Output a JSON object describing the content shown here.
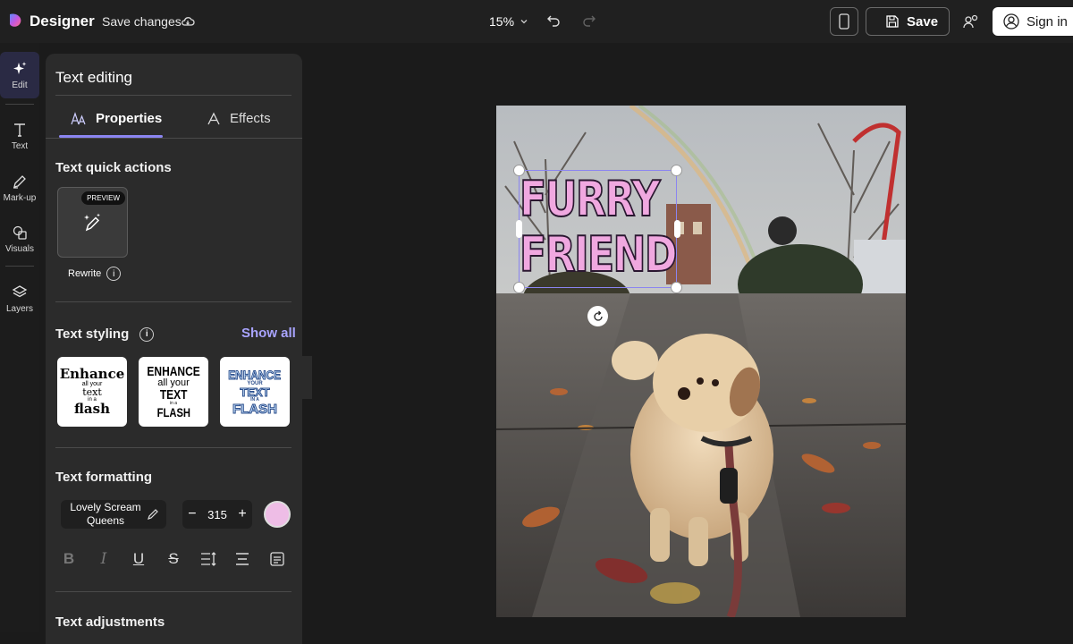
{
  "header": {
    "app_title": "Designer",
    "save_changes": "Save changes",
    "zoom": "15%",
    "save_label": "Save",
    "signin_label": "Sign in"
  },
  "rail": {
    "items": [
      {
        "label": "Edit",
        "icon": "sparkle-icon"
      },
      {
        "label": "Text",
        "icon": "text-icon"
      },
      {
        "label": "Mark-up",
        "icon": "pen-icon"
      },
      {
        "label": "Visuals",
        "icon": "shapes-icon"
      },
      {
        "label": "Layers",
        "icon": "layers-icon"
      }
    ]
  },
  "panel": {
    "title": "Text editing",
    "tabs": [
      {
        "label": "Properties",
        "active": true
      },
      {
        "label": "Effects",
        "active": false
      }
    ],
    "quick_actions": {
      "title": "Text quick actions",
      "badge": "PREVIEW",
      "rewrite_label": "Rewrite"
    },
    "styling": {
      "title": "Text styling",
      "show_all": "Show all",
      "presets": [
        {
          "line1": "Enhance",
          "line2": "all your",
          "line3": "text",
          "line4": "in a",
          "line5": "flash"
        },
        {
          "line1": "ENHANCE",
          "line2": "all your",
          "line3": "TEXT",
          "line4": "in a",
          "line5": "FLASH"
        },
        {
          "line1": "ENHANCE",
          "line2": "YOUR",
          "line3": "TEXT",
          "line4": "IN A",
          "line5": "FLASH"
        }
      ]
    },
    "formatting": {
      "title": "Text formatting",
      "font_name": "Lovely Scream Queens",
      "size": "315",
      "color": "#eebde6"
    },
    "adjustments": {
      "title": "Text adjustments"
    }
  },
  "canvas": {
    "headline_line1": "FURRY",
    "headline_line2": "FRIEND"
  },
  "colors": {
    "accent": "#8b85f0",
    "text_fill": "#f0a8e0"
  }
}
